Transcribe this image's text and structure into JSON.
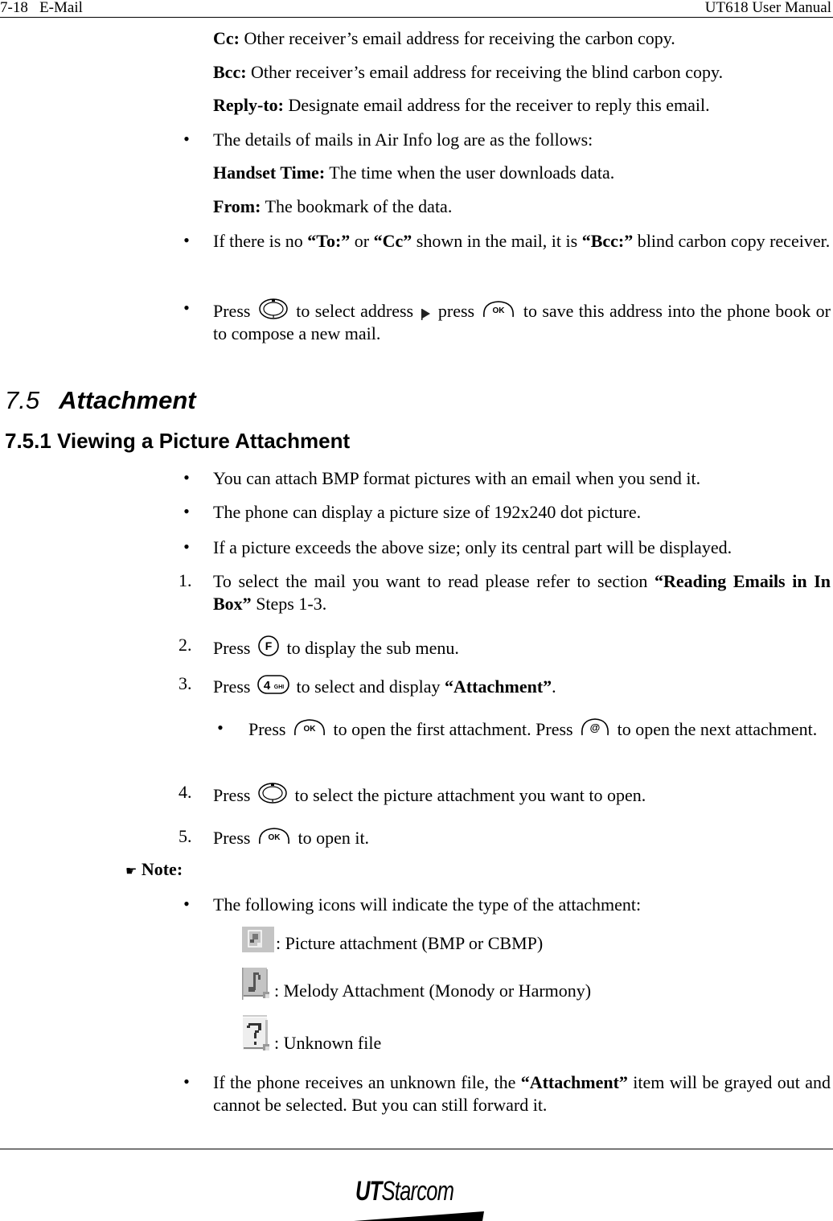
{
  "header": {
    "left": "7-18   E-Mail",
    "right": "UT618 User Manual"
  },
  "fields": [
    {
      "label": "Cc:",
      "text": " Other receiver’s email address for receiving the carbon copy."
    },
    {
      "label": "Bcc:",
      "text": " Other receiver’s email address for receiving the blind carbon copy."
    },
    {
      "label": "Reply-to:",
      "text": " Designate email address for the receiver to reply this email."
    }
  ],
  "airinfo": {
    "bullet": "The details of mails in Air Info log are as the follows:",
    "fields": [
      {
        "label": "Handset Time:",
        "text": " The time when the user downloads data."
      },
      {
        "label": "From:",
        "text": " The bookmark of the data."
      }
    ]
  },
  "bcc_note": {
    "p1": "If there is no ",
    "b1": "“To:”",
    "p2": " or ",
    "b2": "“Cc”",
    "p3": " shown in the mail, it is ",
    "b3": "“Bcc:”",
    "p4": " blind carbon copy receiver."
  },
  "press_note": {
    "p1": "Press ",
    "p2": " to select address ",
    "p3": " press ",
    "p4": " to save this address into the phone book or to compose a new mail."
  },
  "section": {
    "number": "7.5",
    "title": "Attachment"
  },
  "subsection": {
    "title": "7.5.1 Viewing a Picture Attachment"
  },
  "intro_bullets": [
    "You can attach BMP format pictures with an email when you send it.",
    "The phone can display a picture size of 192x240 dot picture.",
    "If a picture exceeds the above size; only its central part will be displayed."
  ],
  "steps": {
    "s1": {
      "num": "1.",
      "p1": "To select the mail you want to read please refer to section ",
      "b1": "“Reading Emails in In Box”",
      "p2": " Steps 1-3."
    },
    "s2": {
      "num": "2.",
      "p1": "Press ",
      "p2": " to display the sub menu."
    },
    "s3": {
      "num": "3.",
      "p1": "Press ",
      "p2": " to select and display ",
      "b1": "“Attachment”",
      "p3": "."
    },
    "s3_sub": {
      "p1": "Press ",
      "p2": " to open the first attachment. Press ",
      "p3": " to open the next attachment."
    },
    "s4": {
      "num": "4.",
      "p1": "Press ",
      "p2": " to select the picture attachment you want to open."
    },
    "s5": {
      "num": "5.",
      "p1": "Press ",
      "p2": " to open it."
    }
  },
  "keys": {
    "ok": "OK",
    "f": "F",
    "four": "4",
    "four_sub": "GHI",
    "at": "@"
  },
  "note": {
    "icon": "☛",
    "label": "Note:",
    "bullet": "The following icons will indicate the type of the attachment:",
    "icons": [
      {
        "icon": "picture-file-icon",
        "text": ": Picture attachment (BMP or CBMP)"
      },
      {
        "icon": "melody-file-icon",
        "text": ": Melody Attachment (Monody or Harmony)"
      },
      {
        "icon": "unknown-file-icon",
        "text": ": Unknown file"
      }
    ],
    "unknown": {
      "p1": "If the phone receives an unknown file, the ",
      "b1": "“Attachment”",
      "p2": " item will be grayed out and cannot be selected. But you can still forward it."
    }
  },
  "footer": {
    "logo_bold": "UT",
    "logo_rest": "Starcom"
  }
}
